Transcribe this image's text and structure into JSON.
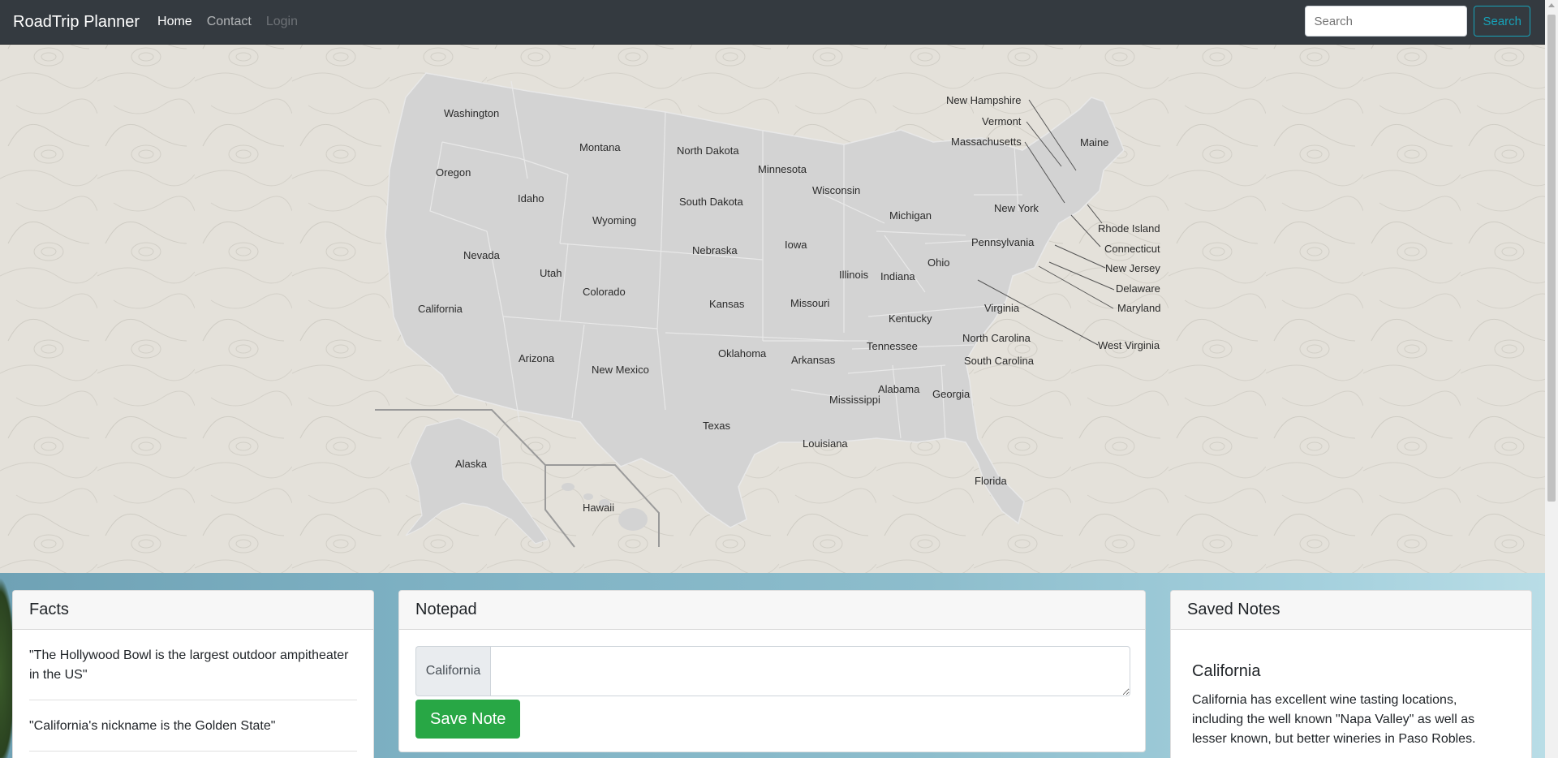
{
  "navbar": {
    "brand": "RoadTrip Planner",
    "links": [
      {
        "label": "Home",
        "state": "active"
      },
      {
        "label": "Contact",
        "state": "normal"
      },
      {
        "label": "Login",
        "state": "disabled"
      }
    ],
    "search_placeholder": "Search",
    "search_button": "Search"
  },
  "map": {
    "states": [
      {
        "name": "Washington"
      },
      {
        "name": "Oregon"
      },
      {
        "name": "Idaho"
      },
      {
        "name": "Montana"
      },
      {
        "name": "North Dakota"
      },
      {
        "name": "Minnesota"
      },
      {
        "name": "Wisconsin"
      },
      {
        "name": "Michigan"
      },
      {
        "name": "South Dakota"
      },
      {
        "name": "Wyoming"
      },
      {
        "name": "Nevada"
      },
      {
        "name": "Utah"
      },
      {
        "name": "Nebraska"
      },
      {
        "name": "Iowa"
      },
      {
        "name": "Illinois"
      },
      {
        "name": "Indiana"
      },
      {
        "name": "Ohio"
      },
      {
        "name": "Pennsylvania"
      },
      {
        "name": "New York"
      },
      {
        "name": "California"
      },
      {
        "name": "Colorado"
      },
      {
        "name": "Kansas"
      },
      {
        "name": "Missouri"
      },
      {
        "name": "Kentucky"
      },
      {
        "name": "Virginia"
      },
      {
        "name": "Arizona"
      },
      {
        "name": "New Mexico"
      },
      {
        "name": "Oklahoma"
      },
      {
        "name": "Arkansas"
      },
      {
        "name": "Tennessee"
      },
      {
        "name": "North Carolina"
      },
      {
        "name": "South Carolina"
      },
      {
        "name": "Alabama"
      },
      {
        "name": "Mississippi"
      },
      {
        "name": "Georgia"
      },
      {
        "name": "Texas"
      },
      {
        "name": "Louisiana"
      },
      {
        "name": "Florida"
      },
      {
        "name": "Alaska"
      },
      {
        "name": "Hawaii"
      },
      {
        "name": "Maine"
      },
      {
        "name": "New Hampshire"
      },
      {
        "name": "Vermont"
      },
      {
        "name": "Massachusetts"
      },
      {
        "name": "Rhode Island"
      },
      {
        "name": "Connecticut"
      },
      {
        "name": "New Jersey"
      },
      {
        "name": "Delaware"
      },
      {
        "name": "Maryland"
      },
      {
        "name": "West Virginia"
      }
    ]
  },
  "facts": {
    "title": "Facts",
    "items": [
      "\"The Hollywood Bowl is the largest outdoor ampitheater in the US\"",
      "\"California's nickname is the Golden State\""
    ]
  },
  "notepad": {
    "title": "Notepad",
    "state_label": "California",
    "note_value": "",
    "save_button": "Save Note"
  },
  "saved_notes": {
    "title": "Saved Notes",
    "notes": [
      {
        "state": "California",
        "text": "California has excellent wine tasting locations, including the well known \"Napa Valley\" as well as lesser known, but better wineries in Paso Robles."
      }
    ]
  },
  "colors": {
    "navbar_bg": "#343a40",
    "map_bg": "#e4e1da",
    "state_fill": "#d3d3d3",
    "search_accent": "#17a2b8",
    "save_green": "#28a745"
  }
}
